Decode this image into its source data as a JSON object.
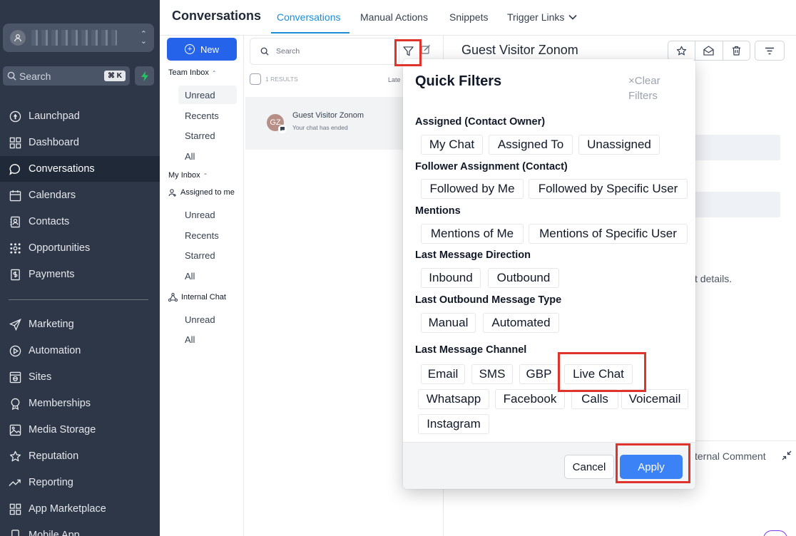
{
  "sidebar": {
    "search_label": "Search",
    "search_shortcut": "⌘ K",
    "nav": [
      {
        "label": "Launchpad",
        "icon": "launchpad-icon"
      },
      {
        "label": "Dashboard",
        "icon": "dashboard-icon"
      },
      {
        "label": "Conversations",
        "icon": "chat-bubble-icon",
        "active": true
      },
      {
        "label": "Calendars",
        "icon": "calendar-icon"
      },
      {
        "label": "Contacts",
        "icon": "contacts-icon"
      },
      {
        "label": "Opportunities",
        "icon": "opportunities-icon"
      },
      {
        "label": "Payments",
        "icon": "payments-icon"
      },
      {
        "label": "Marketing",
        "icon": "send-icon"
      },
      {
        "label": "Automation",
        "icon": "automation-icon"
      },
      {
        "label": "Sites",
        "icon": "sites-icon"
      },
      {
        "label": "Memberships",
        "icon": "memberships-icon"
      },
      {
        "label": "Media Storage",
        "icon": "image-icon"
      },
      {
        "label": "Reputation",
        "icon": "star-icon"
      },
      {
        "label": "Reporting",
        "icon": "trend-icon"
      },
      {
        "label": "App Marketplace",
        "icon": "grid-icon"
      },
      {
        "label": "Mobile App",
        "icon": "mobile-icon"
      }
    ]
  },
  "topbar": {
    "title": "Conversations",
    "tabs": [
      {
        "label": "Conversations",
        "active": true
      },
      {
        "label": "Manual Actions"
      },
      {
        "label": "Snippets"
      },
      {
        "label": "Trigger Links"
      }
    ]
  },
  "inbox": {
    "new_label": "New",
    "team_inbox": "Team Inbox",
    "team_items": [
      "Unread",
      "Recents",
      "Starred",
      "All"
    ],
    "my_inbox": "My Inbox",
    "assigned_to_me": "Assigned to me",
    "my_items": [
      "Unread",
      "Recents",
      "Starred",
      "All"
    ],
    "internal_chat": "Internal Chat",
    "internal_items": [
      "Unread",
      "All"
    ]
  },
  "conv_list": {
    "search_placeholder": "Search",
    "results": "1 RESULTS",
    "sort_label": "Late",
    "item": {
      "initials": "GZ",
      "name": "Guest Visitor Zonom",
      "preview": "Your chat has ended"
    }
  },
  "detail": {
    "title": "Guest Visitor Zonom",
    "details_text": "t details.",
    "comment_text": "ternal Comment"
  },
  "quick_filters": {
    "title": "Quick Filters",
    "clear_label": "Clear Filters",
    "sections": [
      {
        "title": "Assigned (Contact Owner)",
        "chips": [
          "My Chat",
          "Assigned To",
          "Unassigned"
        ]
      },
      {
        "title": "Follower Assignment (Contact)",
        "chips": [
          "Followed by Me",
          "Followed by Specific User"
        ]
      },
      {
        "title": "Mentions",
        "chips": [
          "Mentions of Me",
          "Mentions of Specific User"
        ]
      },
      {
        "title": "Last Message Direction",
        "chips": [
          "Inbound",
          "Outbound"
        ]
      },
      {
        "title": "Last Outbound Message Type",
        "chips": [
          "Manual",
          "Automated"
        ]
      },
      {
        "title": "Last Message Channel",
        "chips": [
          "Email",
          "SMS",
          "GBP",
          "Live Chat",
          "Whatsapp",
          "Facebook",
          "Calls",
          "Voicemail",
          "Instagram"
        ]
      }
    ],
    "cancel_label": "Cancel",
    "apply_label": "Apply"
  },
  "colors": {
    "sidebar_bg": "#2d3748",
    "accent_tab": "#1a8fd8",
    "primary_button": "#2563eb",
    "apply_button": "#3b82f6",
    "highlight": "#e0332b"
  }
}
